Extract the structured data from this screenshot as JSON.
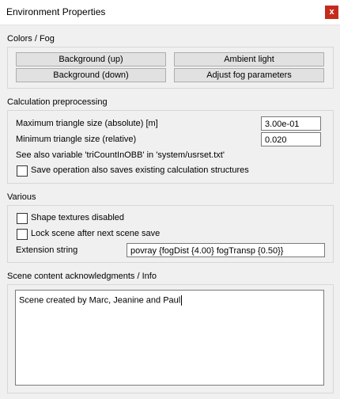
{
  "window": {
    "title": "Environment Properties",
    "close_label": "x"
  },
  "colors_fog": {
    "label": "Colors / Fog",
    "buttons": {
      "background_up": "Background (up)",
      "ambient_light": "Ambient light",
      "background_down": "Background (down)",
      "adjust_fog": "Adjust fog parameters"
    }
  },
  "calc": {
    "label": "Calculation preprocessing",
    "max_triangle_label": "Maximum triangle size (absolute) [m]",
    "max_triangle_value": "3.00e-01",
    "min_triangle_label": "Minimum triangle size (relative)",
    "min_triangle_value": "0.020",
    "see_also_text": "See also variable 'triCountInOBB' in 'system/usrset.txt'",
    "save_operation_label": "Save operation also saves existing calculation structures",
    "save_operation_checked": false
  },
  "various": {
    "label": "Various",
    "shape_textures_label": "Shape textures disabled",
    "shape_textures_checked": false,
    "lock_scene_label": "Lock scene after next scene save",
    "lock_scene_checked": false,
    "extension_label": "Extension string",
    "extension_value": "povray {fogDist {4.00} fogTransp {0.50}}"
  },
  "info": {
    "label": "Scene content acknowledgments / Info",
    "text": "Scene created by Marc, Jeanine and Paul"
  }
}
